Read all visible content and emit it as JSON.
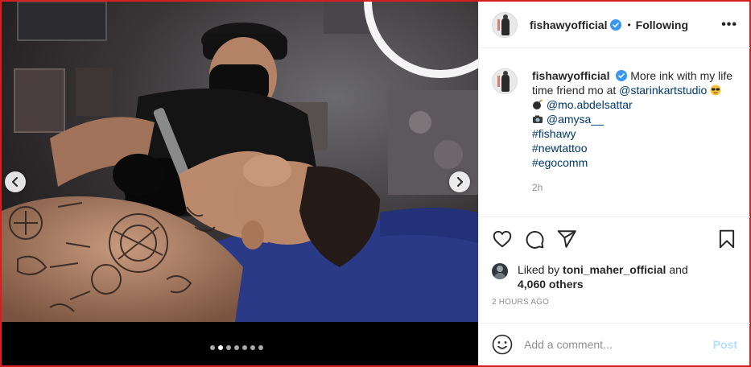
{
  "post": {
    "username": "fishawyofficial",
    "follow_separator": "•",
    "follow_status": "Following",
    "more_label": "•••"
  },
  "caption": {
    "username": "fishawyofficial",
    "line1": "More ink with my life time friend mo at",
    "studio_mention": "@starinkartstudio",
    "mention1": "@mo.abdelsattar",
    "mention2": "@amysa__",
    "hashtags": [
      "#fishawy",
      "#newtattoo",
      "#egocomm"
    ],
    "time_ago": "2h"
  },
  "likes": {
    "prefix": "Liked by",
    "user": "toni_maher_official",
    "conjunction": "and",
    "others": "4,060 others"
  },
  "timestamp": "2 HOURS AGO",
  "comment": {
    "placeholder": "Add a comment...",
    "post_label": "Post"
  },
  "carousel": {
    "slide_count": 7,
    "active_index": 1
  },
  "colors": {
    "accent_link": "#00376b",
    "verified": "#3897f0",
    "post_disabled": "#b2dffc",
    "frame_border": "#d81f1f"
  }
}
